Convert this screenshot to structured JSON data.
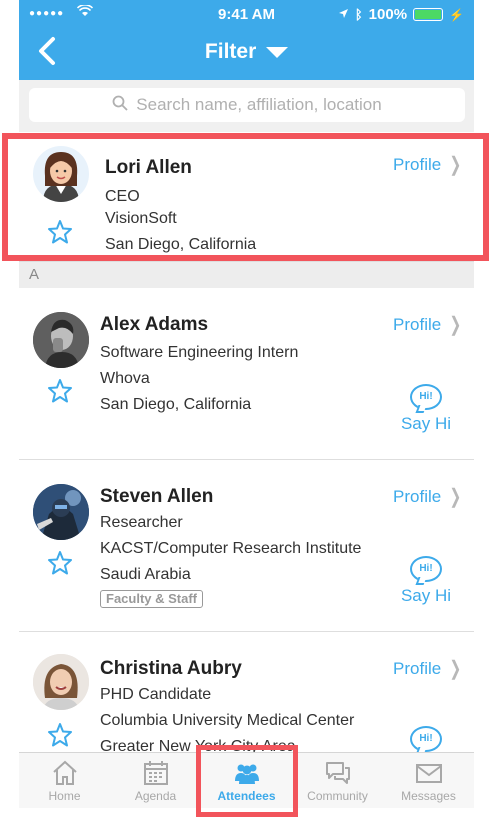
{
  "status_bar": {
    "time": "9:41 AM",
    "battery": "100%"
  },
  "header": {
    "title": "Filter"
  },
  "search": {
    "placeholder": "Search name, affiliation, location"
  },
  "self": {
    "name": "Lori Allen",
    "title": "CEO",
    "org": "VisionSoft",
    "location": "San Diego, California",
    "profile_label": "Profile"
  },
  "section_letter": "A",
  "attendees": [
    {
      "name": "Alex Adams",
      "title": "Software Engineering Intern",
      "org": "Whova",
      "location": "San Diego, California",
      "profile_label": "Profile",
      "sayhi_label": "Say Hi",
      "bubble": "Hi!"
    },
    {
      "name": "Steven Allen",
      "title": "Researcher",
      "org": "KACST/Computer Research Institute",
      "location": "Saudi Arabia",
      "badge": "Faculty & Staff",
      "profile_label": "Profile",
      "sayhi_label": "Say Hi",
      "bubble": "Hi!"
    },
    {
      "name": "Christina Aubry",
      "title": "PHD Candidate",
      "org": "Columbia University Medical Center",
      "location": "Greater New York City Area",
      "profile_label": "Profile",
      "bubble": "Hi!"
    }
  ],
  "tabs": [
    {
      "label": "Home",
      "icon": "home-icon"
    },
    {
      "label": "Agenda",
      "icon": "calendar-icon"
    },
    {
      "label": "Attendees",
      "icon": "people-icon",
      "active": true
    },
    {
      "label": "Community",
      "icon": "chat-bubbles-icon"
    },
    {
      "label": "Messages",
      "icon": "envelope-icon"
    }
  ],
  "colors": {
    "accent": "#3daaea",
    "highlight": "#f2545b",
    "battery": "#4cd964"
  }
}
